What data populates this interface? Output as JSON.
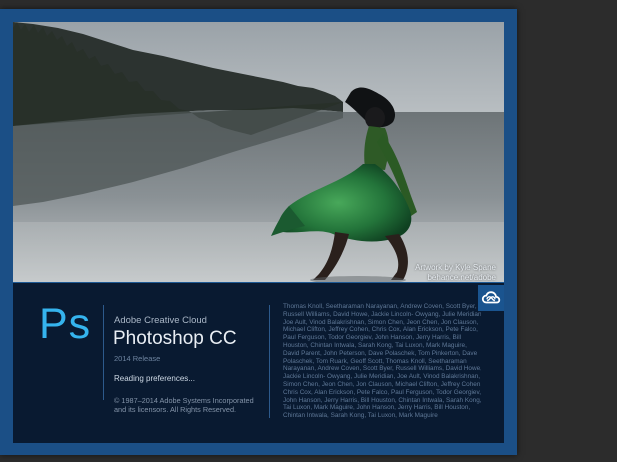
{
  "splash": {
    "artwork_credit": {
      "line1": "Artwork by Kyle Spane",
      "line2": "behance.net/adobe"
    },
    "app_logo": "Ps",
    "suite_name": "Adobe Creative Cloud",
    "product_name": "Photoshop CC",
    "release": "2014 Release",
    "status": "Reading preferences...",
    "copyright": [
      "© 1987–2014 Adobe Systems Incorporated",
      "and its licensors. All Rights Reserved."
    ],
    "credits": [
      "Thomas Knoll, Seetharaman Narayanan, Andrew Coven, Scott Byer,",
      "Russell Williams, David Howe, Jackie Lincoln- Owyang, Julie Meridian,",
      "Joe Ault, Vinod Balakrishnan, Simon Chen, Jeon Chen, Jon Clauson,",
      "Michael Clifton, Jeffrey Cohen, Chris Cox, Alan Erickson, Pete Falco,",
      "Paul Ferguson, Todor Georgiev, John Hanson, Jerry Harris, Bill",
      "Houston, Chintan Intwala, Sarah Kong, Tai Luxon, Mark Maguire,",
      "David Parent, John Peterson, Dave Polaschek, Tom Pinkerton, Dave",
      "Polaschek, Tom Ruark, Geoff Scott, Thomas Knoll, Seetharaman",
      "Narayanan, Andrew Coven, Scott Byer, Russell Williams, David Howe,",
      "Jackie Lincoln- Owyang, Julie Meridian, Joe Ault, Vinod Balakrishnan,",
      "Simon Chen, Jeon Chen, Jon Clauson, Michael Clifton, Jeffrey Cohen,",
      "Chris Cox, Alan Erickson, Pete Falco, Paul Ferguson, Todor Georgiev,",
      "John Hanson, Jerry Harris, Bill Houston, Chintan Intwala, Sarah Kong,",
      "Tai Luxon, Mark Maguire, John Hanson, Jerry Harris, Bill Houston,",
      "Chintan Intwala, Sarah Kong, Tai Luxon, Mark Maguire"
    ],
    "badge_icon": "creative-cloud-icon",
    "colors": {
      "frame": "#1b4f86",
      "logo": "#35b4ee",
      "panel": "#091a31"
    }
  }
}
